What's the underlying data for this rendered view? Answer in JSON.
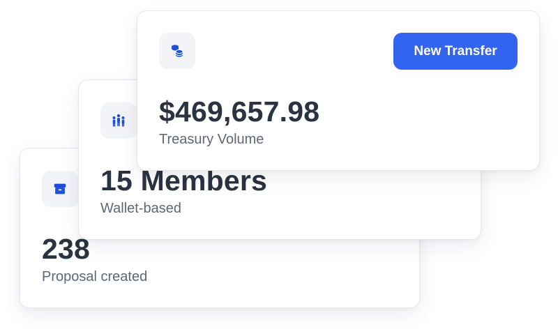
{
  "colors": {
    "accent": "#3264f0",
    "icon": "#1f4ed8",
    "text_primary": "#2b3340",
    "text_secondary": "#5f6775"
  },
  "cards": {
    "proposals": {
      "icon": "box-icon",
      "value": "238",
      "label": "Proposal created"
    },
    "members": {
      "icon": "people-icon",
      "value": "15 Members",
      "label": "Wallet-based"
    },
    "treasury": {
      "icon": "coins-icon",
      "value": "$469,657.98",
      "label": "Treasury Volume",
      "button_label": "New Transfer"
    }
  }
}
